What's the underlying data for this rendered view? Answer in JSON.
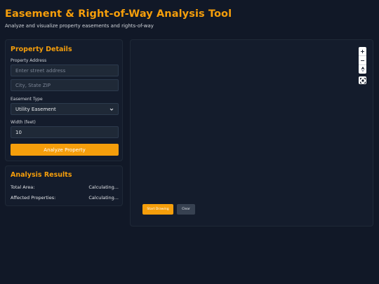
{
  "header": {
    "title": "Easement & Right-of-Way Analysis Tool",
    "subtitle": "Analyze and visualize property easements and rights-of-way"
  },
  "details": {
    "heading": "Property Details",
    "address_label": "Property Address",
    "street_placeholder": "Enter street address",
    "city_placeholder": "City, State ZIP",
    "easement_label": "Easement Type",
    "easement_selected": "Utility Easement",
    "width_label": "Width (feet)",
    "width_value": "10",
    "analyze_label": "Analyze Property"
  },
  "results": {
    "heading": "Analysis Results",
    "rows": [
      {
        "label": "Total Area:",
        "value": "Calculating..."
      },
      {
        "label": "Affected Properties:",
        "value": "Calculating..."
      }
    ]
  },
  "map": {
    "zoom_in": "+",
    "zoom_out": "−",
    "start_drawing_label": "Start Drawing",
    "clear_label": "Clear"
  },
  "colors": {
    "accent": "#f59e0b",
    "background": "#111827",
    "panel": "#141c2c"
  }
}
